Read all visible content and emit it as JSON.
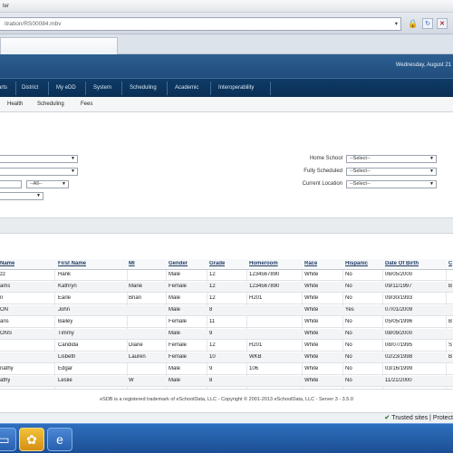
{
  "browser": {
    "title_text": "ter",
    "url": "itration/RS00084.mbv",
    "status": "Trusted sites | Protect"
  },
  "header": {
    "date": "Wednesday, August 21"
  },
  "mainnav": {
    "items": [
      "arts",
      "District",
      "My eDD",
      "System",
      "Scheduling",
      "Academic",
      "Interoperability"
    ]
  },
  "subnav": {
    "items": [
      "Health",
      "Scheduling",
      "Fees"
    ]
  },
  "search": {
    "all_option": "--All--",
    "right_fields": [
      {
        "label": "Home School",
        "value": "--Select--"
      },
      {
        "label": "Fully Scheduled",
        "value": "--Select--"
      },
      {
        "label": "Current Location",
        "value": "--Select--"
      }
    ]
  },
  "grid": {
    "columns": [
      "Name",
      "First Name",
      "MI",
      "Gender",
      "Grade",
      "Homeroom",
      "Race",
      "Hispanic",
      "Date Of Birth",
      "C"
    ],
    "rows": [
      [
        "zz",
        "Hank",
        "",
        "Male",
        "12",
        "1234567890",
        "White",
        "No",
        "06/05/2000",
        ""
      ],
      [
        "ams",
        "Kathryn",
        "Marie",
        "Female",
        "12",
        "1234567890",
        "White",
        "No",
        "09/11/1997",
        "B"
      ],
      [
        "n",
        "Earle",
        "Brian",
        "Male",
        "12",
        "H201",
        "White",
        "No",
        "09/30/1993",
        ""
      ],
      [
        "ON",
        "John",
        "",
        "Male",
        "8",
        "",
        "White",
        "Yes",
        "07/01/2009",
        ""
      ],
      [
        "ans",
        "Bailey",
        "",
        "Female",
        "11",
        "",
        "White",
        "No",
        "05/05/1996",
        "B"
      ],
      [
        "ONS",
        "Timmy",
        "",
        "Male",
        "9",
        "",
        "White",
        "No",
        "08/09/2000",
        ""
      ],
      [
        "",
        "Candida",
        "Diane",
        "Female",
        "12",
        "H201",
        "White",
        "No",
        "08/07/1995",
        "S"
      ],
      [
        "",
        "Lisbeth",
        "Lauren",
        "Female",
        "10",
        "WKB",
        "White",
        "No",
        "02/23/1998",
        "B"
      ],
      [
        "nathy",
        "Edgar",
        "",
        "Male",
        "9",
        "106",
        "White",
        "No",
        "03/16/1999",
        ""
      ],
      [
        "athy",
        "Leslie",
        "W",
        "Male",
        "8",
        "",
        "White",
        "No",
        "11/21/2000",
        ""
      ]
    ]
  },
  "footer": {
    "text": "eSDB is a registered trademark of eSchoolData, LLC - Copyright © 2001-2013 eSchoolData, LLC - Server 3 - 3.5.0"
  },
  "taskbar": {
    "items": [
      {
        "icon": "folder-icon",
        "glyph": "▭"
      },
      {
        "icon": "app-icon",
        "glyph": "✿"
      },
      {
        "icon": "browser-icon",
        "glyph": "e"
      }
    ]
  }
}
